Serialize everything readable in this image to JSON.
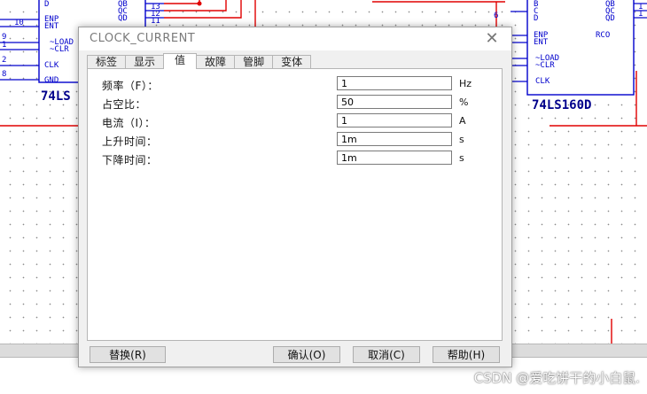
{
  "dialog": {
    "title": "CLOCK_CURRENT",
    "tabs": [
      {
        "label": "标签"
      },
      {
        "label": "显示"
      },
      {
        "label": "值"
      },
      {
        "label": "故障"
      },
      {
        "label": "管脚"
      },
      {
        "label": "变体"
      }
    ],
    "active_tab": "值",
    "fields": [
      {
        "label": "频率（F）：",
        "value": "1",
        "unit": "Hz"
      },
      {
        "label": "占空比：",
        "value": "50",
        "unit": "%"
      },
      {
        "label": "电流（I）：",
        "value": "1",
        "unit": "A"
      },
      {
        "label": "上升时间：",
        "value": "1m",
        "unit": "s"
      },
      {
        "label": "下降时间：",
        "value": "1m",
        "unit": "s"
      }
    ],
    "buttons": {
      "replace": "替换(R)",
      "ok": "确认(O)",
      "cancel": "取消(C)",
      "help": "帮助(H)"
    }
  },
  "schematic": {
    "left_chip": {
      "name": "74LS",
      "pins": [
        "D",
        "ENP",
        "ENT",
        "~LOAD",
        "~CLR",
        "CLK",
        "GND"
      ],
      "outputs": [
        "QB",
        "QC",
        "QD"
      ],
      "pin_numbers": [
        "9",
        "1",
        "10",
        "2",
        "8"
      ],
      "wire_numbers": [
        "13",
        "12",
        "11"
      ]
    },
    "right_chip": {
      "name": "74LS160D",
      "pins": [
        "B",
        "C",
        "D",
        "ENP",
        "ENT",
        "~LOAD",
        "~CLR",
        "CLK"
      ],
      "outputs": [
        "QB",
        "QC",
        "QD",
        "RCO"
      ],
      "pin_numbers": [
        "6"
      ],
      "wire_numbers": [
        "1",
        "1"
      ]
    }
  },
  "watermark": "CSDN @爱吃饼干的小白鼠."
}
